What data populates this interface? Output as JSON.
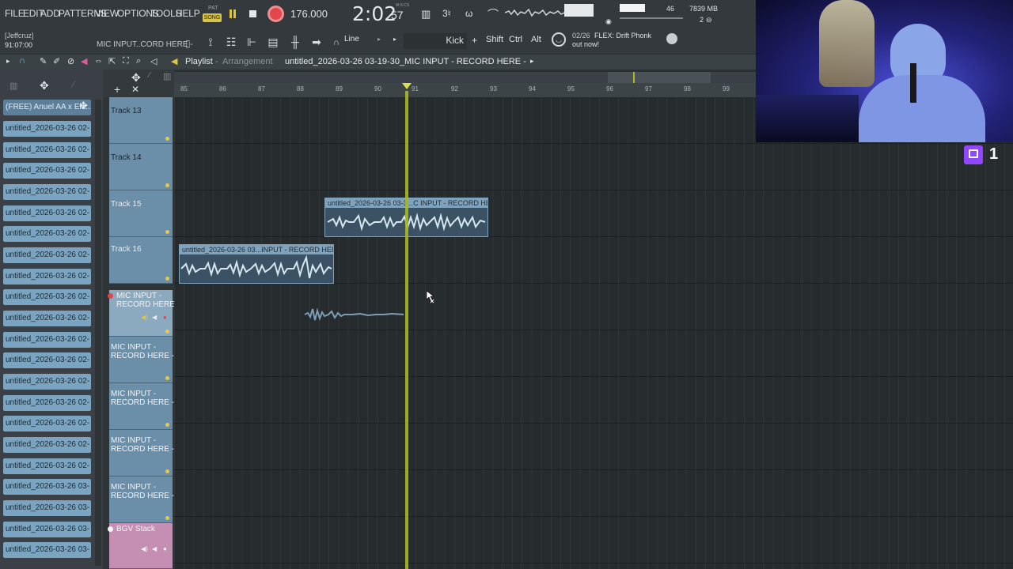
{
  "menu": [
    "FILE",
    "EDIT",
    "ADD",
    "PATTERNS",
    "VIEW",
    "OPTIONS",
    "TOOLS",
    "HELP"
  ],
  "transport": {
    "pat_label": "PAT",
    "song_label": "SONG",
    "tempo": "176.000",
    "time": "2:02",
    "time_small": "57",
    "time_unit": "M:S:CS",
    "memory": "7839 MB",
    "cpu": "46",
    "voices": "2"
  },
  "user": {
    "name": "[Jeffcruz]",
    "time": "91:07:00"
  },
  "hint": "MIC INPUT..CORD HERE -",
  "snap_mode": "Line",
  "instrument": "Kick",
  "modifiers": [
    "Shift",
    "Ctrl",
    "Alt"
  ],
  "news": {
    "date": "02/26",
    "text": "FLEX: Drift Phonk",
    "text2": "out now!"
  },
  "playlist": {
    "title": "Playlist",
    "sub": "Arrangement",
    "pattern": "untitled_2026-03-26 03-19-30_MIC INPUT - RECORD HERE -"
  },
  "ruler": [
    "85",
    "86",
    "87",
    "88",
    "89",
    "90",
    "91",
    "92",
    "93",
    "94",
    "95",
    "96",
    "97",
    "98",
    "99"
  ],
  "browser": {
    "items": [
      "(FREE) Anuel AA x Ela...",
      "untitled_2026-03-26 02-",
      "untitled_2026-03-26 02-",
      "untitled_2026-03-26 02-",
      "untitled_2026-03-26 02-",
      "untitled_2026-03-26 02-",
      "untitled_2026-03-26 02-",
      "untitled_2026-03-26 02-",
      "untitled_2026-03-26 02-",
      "untitled_2026-03-26 02-",
      "untitled_2026-03-26 02-",
      "untitled_2026-03-26 02-",
      "untitled_2026-03-26 02-",
      "untitled_2026-03-26 02-",
      "untitled_2026-03-26 02-",
      "untitled_2026-03-26 02-",
      "untitled_2026-03-26 02-",
      "untitled_2026-03-26 02-",
      "untitled_2026-03-26 03-",
      "untitled_2026-03-26 03-",
      "untitled_2026-03-26 03-"
    ]
  },
  "tracks": [
    {
      "name": "Track 13"
    },
    {
      "name": "Track 14"
    },
    {
      "name": "Track 15"
    },
    {
      "name": "Track 16"
    },
    {
      "name": "MIC INPUT -\nRECORD HERE -"
    },
    {
      "name": "MIC INPUT -\nRECORD HERE -"
    },
    {
      "name": "MIC INPUT -\nRECORD HERE -"
    },
    {
      "name": "MIC INPUT -\nRECORD HERE -"
    },
    {
      "name": "MIC INPUT -\nRECORD HERE -"
    },
    {
      "name": "BGV Stack"
    }
  ],
  "clips": [
    {
      "label": "untitled_2026-03-26 03-3...C INPUT - RECORD HERE -"
    },
    {
      "label": "untitled_2026-03-26 03...INPUT - RECORD HERE -"
    }
  ],
  "webcam": {
    "viewer_count": "1"
  },
  "colors": {
    "accent": "#aab823",
    "clip": "#7fa3bd",
    "track": "#6b8ea9",
    "bgv": "#c48fb3",
    "record": "#e0464b"
  }
}
